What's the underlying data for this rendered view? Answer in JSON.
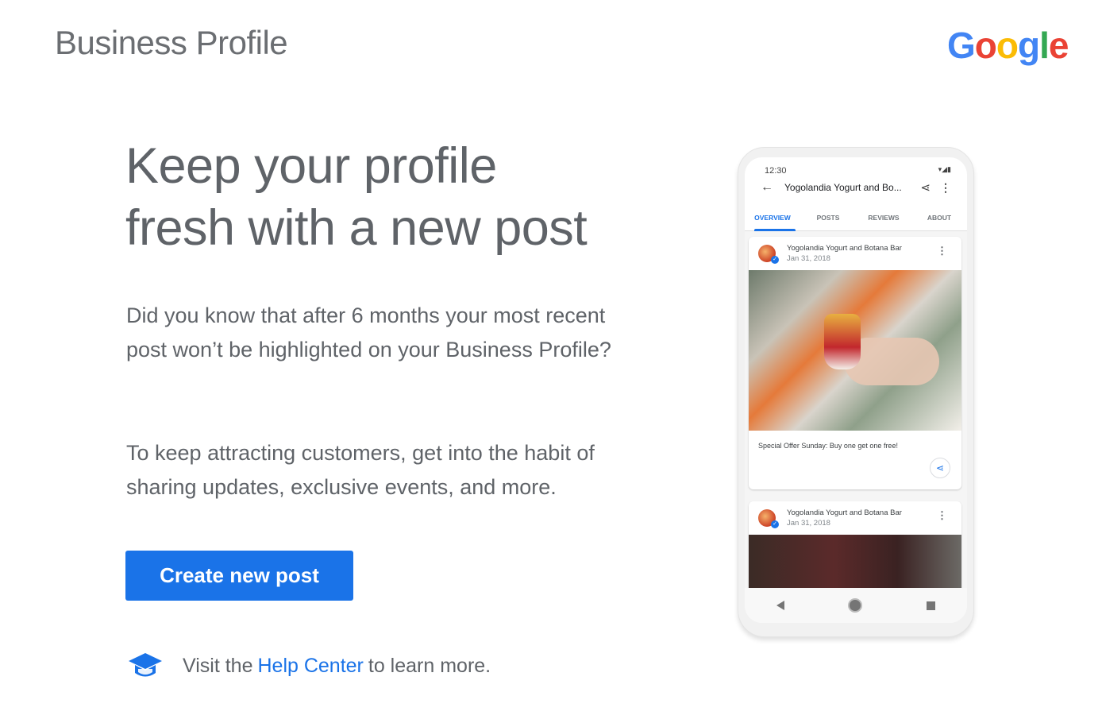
{
  "header": {
    "brand_title": "Business Profile",
    "google_logo": {
      "letters": [
        {
          "char": "G",
          "color": "#4285f4"
        },
        {
          "char": "o",
          "color": "#ea4335"
        },
        {
          "char": "o",
          "color": "#fbbc05"
        },
        {
          "char": "g",
          "color": "#4285f4"
        },
        {
          "char": "l",
          "color": "#34a853"
        },
        {
          "char": "e",
          "color": "#ea4335"
        }
      ]
    }
  },
  "main": {
    "headline_line1": "Keep your profile",
    "headline_line2": "fresh with a new post",
    "paragraph1": "Did you know that after 6 months your most recent post won’t be highlighted on your Business Profile?",
    "paragraph2": "To keep attracting customers, get into the habit of sharing updates, exclusive events, and more.",
    "cta_label": "Create new post",
    "help": {
      "icon": "graduation-cap-icon",
      "prefix": "Visit the",
      "link_text": "Help Center",
      "suffix": "to learn more."
    }
  },
  "phone": {
    "status_time": "12:30",
    "status_icons": "▾◢▮",
    "app_title": "Yogolandia Yogurt and Bo...",
    "back_icon": "←",
    "share_icon": "share-icon",
    "tabs": [
      {
        "label": "OVERVIEW",
        "active": true
      },
      {
        "label": "POSTS",
        "active": false
      },
      {
        "label": "REVIEWS",
        "active": false
      },
      {
        "label": "ABOUT",
        "active": false
      }
    ],
    "posts": [
      {
        "business": "Yogolandia Yogurt and Botana Bar",
        "date": "Jan 31, 2018",
        "caption": "Special Offer Sunday: Buy one get one free!"
      },
      {
        "business": "Yogolandia Yogurt and Botana Bar",
        "date": "Jan 31, 2018"
      }
    ]
  },
  "colors": {
    "accent": "#1a73e8",
    "text": "#5f6368"
  }
}
